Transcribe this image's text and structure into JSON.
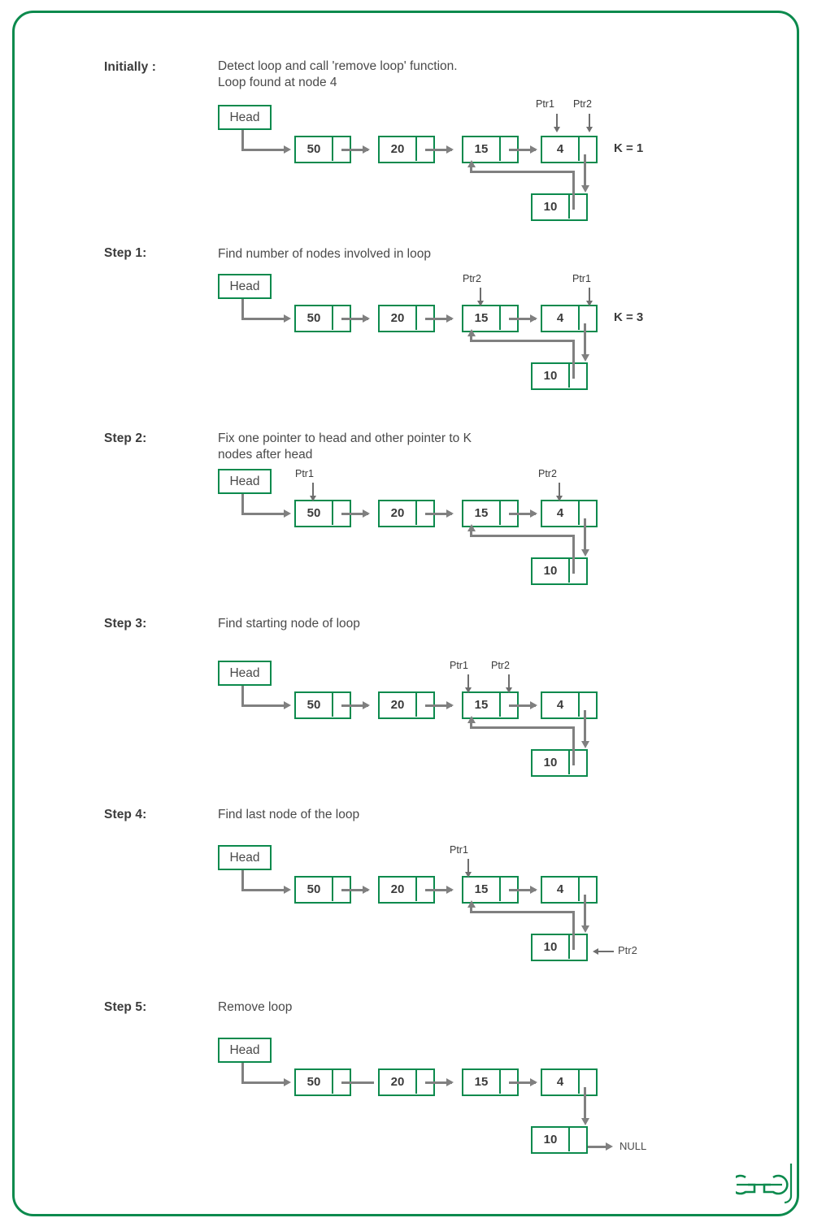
{
  "page": {
    "border_color": "#0c8a4d",
    "node_border_color": "#0c8a4d",
    "arrow_color": "#808080",
    "text_color": "#3b3b3b"
  },
  "logo": {
    "name": "geeksforgeeks-logo",
    "text": "ӘG"
  },
  "sections": [
    {
      "id": "initially",
      "label": "Initially :",
      "description": "Detect loop and call 'remove loop' function.\nLoop found at node 4",
      "head": "Head",
      "nodes": [
        "50",
        "20",
        "15",
        "4"
      ],
      "loop_node": "10",
      "k_label": "K = 1",
      "pointers": [
        {
          "name": "Ptr1",
          "target": "node-4-value"
        },
        {
          "name": "Ptr2",
          "target": "node-4-next"
        }
      ]
    },
    {
      "id": "step1",
      "label": "Step 1:",
      "description": "Find number of nodes involved in loop",
      "head": "Head",
      "nodes": [
        "50",
        "20",
        "15",
        "4"
      ],
      "loop_node": "10",
      "k_label": "K = 3",
      "pointers": [
        {
          "name": "Ptr2",
          "target": "node-15-value"
        },
        {
          "name": "Ptr1",
          "target": "node-4-next"
        }
      ]
    },
    {
      "id": "step2",
      "label": "Step 2:",
      "description": "Fix one pointer to head and other pointer to K\nnodes after head",
      "head": "Head",
      "nodes": [
        "50",
        "20",
        "15",
        "4"
      ],
      "loop_node": "10",
      "k_label": "",
      "pointers": [
        {
          "name": "Ptr1",
          "target": "node-50-value"
        },
        {
          "name": "Ptr2",
          "target": "node-4-value"
        }
      ]
    },
    {
      "id": "step3",
      "label": "Step 3:",
      "description": "Find starting node of loop",
      "head": "Head",
      "nodes": [
        "50",
        "20",
        "15",
        "4"
      ],
      "loop_node": "10",
      "k_label": "",
      "pointers": [
        {
          "name": "Ptr1",
          "target": "node-15-value"
        },
        {
          "name": "Ptr2",
          "target": "node-15-next"
        }
      ]
    },
    {
      "id": "step4",
      "label": "Step 4:",
      "description": "Find last node of the loop",
      "head": "Head",
      "nodes": [
        "50",
        "20",
        "15",
        "4"
      ],
      "loop_node": "10",
      "k_label": "",
      "side_pointer": "Ptr2",
      "pointers": [
        {
          "name": "Ptr1",
          "target": "node-15-value"
        }
      ]
    },
    {
      "id": "step5",
      "label": "Step 5:",
      "description": "Remove loop",
      "head": "Head",
      "nodes": [
        "50",
        "20",
        "15",
        "4"
      ],
      "loop_node": "10",
      "k_label": "",
      "null_label": "NULL",
      "pointers": []
    }
  ]
}
